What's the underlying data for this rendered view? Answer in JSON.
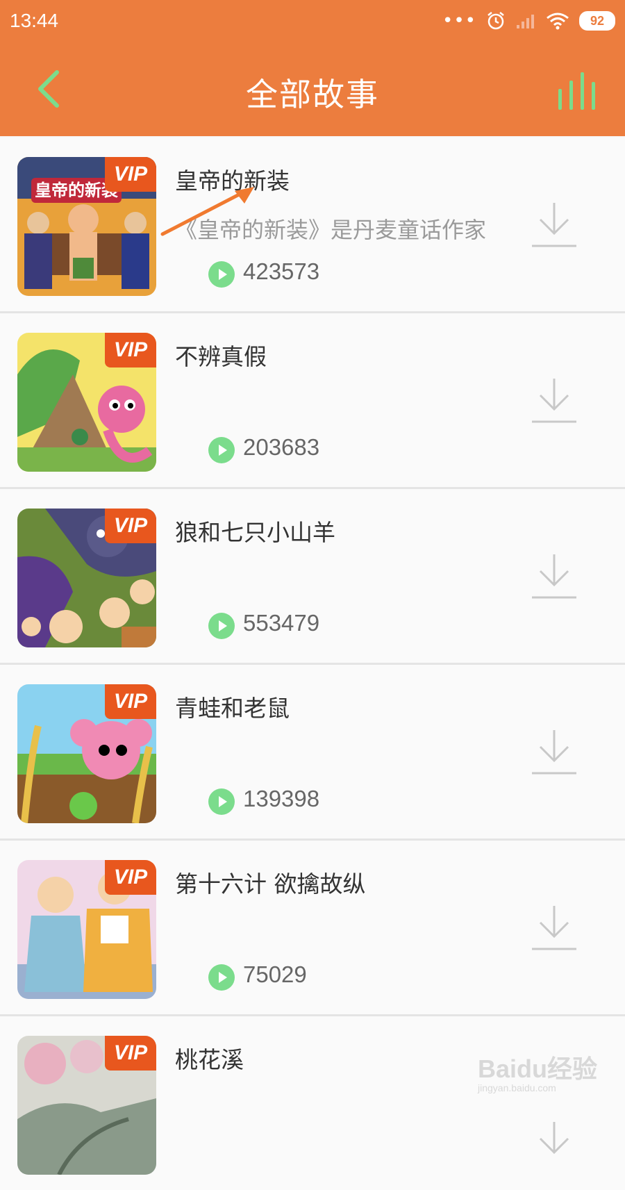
{
  "status_bar": {
    "time": "13:44",
    "battery": "92"
  },
  "header": {
    "title": "全部故事"
  },
  "colors": {
    "header": "#ec7d3e",
    "accent_green": "#7bdc8c",
    "vip": "#e8571e"
  },
  "stories": [
    {
      "title": "皇帝的新装",
      "description": "《皇帝的新装》是丹麦童话作家",
      "badge": "VIP",
      "play_count": "423573",
      "thumb_text": "皇帝的新装"
    },
    {
      "title": "不辨真假",
      "description": "",
      "badge": "VIP",
      "play_count": "203683"
    },
    {
      "title": "狼和七只小山羊",
      "description": "",
      "badge": "VIP",
      "play_count": "553479"
    },
    {
      "title": "青蛙和老鼠",
      "description": "",
      "badge": "VIP",
      "play_count": "139398"
    },
    {
      "title": "第十六计 欲擒故纵",
      "description": "",
      "badge": "VIP",
      "play_count": "75029"
    },
    {
      "title": "桃花溪",
      "description": "",
      "badge": "VIP",
      "play_count": ""
    }
  ],
  "watermark": {
    "logo": "Baidu经验",
    "url": "jingyan.baidu.com"
  }
}
